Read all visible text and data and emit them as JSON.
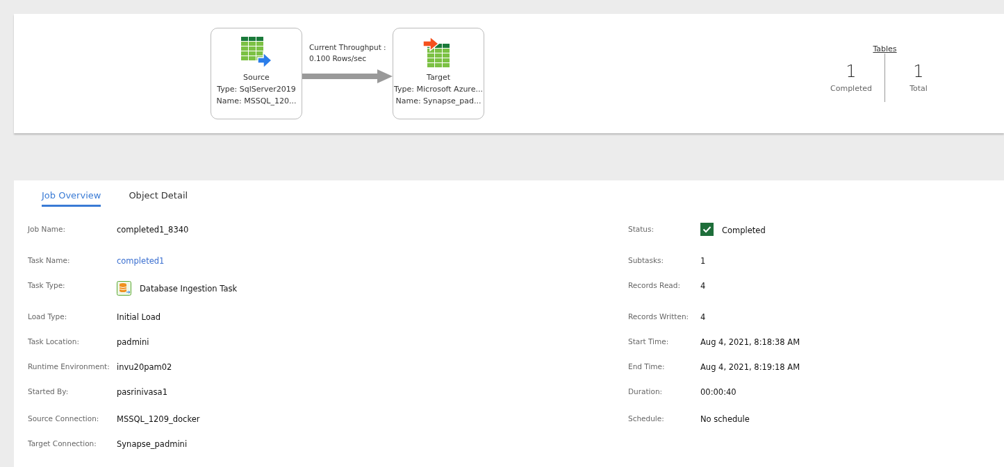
{
  "flow": {
    "source": {
      "title": "Source",
      "type": "Type: SqlServer2019",
      "name": "Name: MSSQL_120..."
    },
    "throughput": {
      "label": "Current Throughput :",
      "value": "0.100 Rows/sec"
    },
    "target": {
      "title": "Target",
      "type": "Type: Microsoft Azure...",
      "name": "Name: Synapse_pad..."
    }
  },
  "tables": {
    "title": "Tables",
    "stats": [
      {
        "value": "1",
        "label": "Completed"
      },
      {
        "value": "1",
        "label": "Total"
      }
    ]
  },
  "tabs": [
    {
      "label": "Job Overview",
      "selected": true
    },
    {
      "label": "Object Detail",
      "selected": false
    }
  ],
  "details_left": [
    {
      "label": "Job Name:",
      "value": "completed1_8340",
      "kind": "text"
    },
    {
      "label": "Task Name:",
      "value": "completed1",
      "kind": "link"
    },
    {
      "label": "Task Type:",
      "value": "Database Ingestion Task",
      "kind": "icon"
    },
    {
      "label": "Load Type:",
      "value": "Initial Load",
      "kind": "text"
    },
    {
      "label": "Task Location:",
      "value": "padmini",
      "kind": "text"
    },
    {
      "label": "Runtime Environment:",
      "value": "invu20pam02",
      "kind": "text"
    },
    {
      "label": "Started By:",
      "value": "pasrinivasa1",
      "kind": "text"
    },
    {
      "label": "Source Connection:",
      "value": "MSSQL_1209_docker",
      "kind": "text"
    },
    {
      "label": "Target Connection:",
      "value": "Synapse_padmini",
      "kind": "text"
    }
  ],
  "details_right": [
    {
      "label": "Status:",
      "value": "Completed",
      "kind": "status",
      "checked": true
    },
    {
      "label": "Subtasks:",
      "value": "1",
      "kind": "text"
    },
    {
      "label": "Records Read:",
      "value": "4",
      "kind": "text"
    },
    {
      "label": "Records Written:",
      "value": "4",
      "kind": "text"
    },
    {
      "label": "Start Time:",
      "value": "Aug 4, 2021, 8:18:38 AM",
      "kind": "text"
    },
    {
      "label": "End Time:",
      "value": "Aug 4, 2021, 8:19:18 AM",
      "kind": "text"
    },
    {
      "label": "Duration:",
      "value": "00:00:40",
      "kind": "text"
    },
    {
      "label": "Schedule:",
      "value": "No schedule",
      "kind": "text"
    }
  ]
}
